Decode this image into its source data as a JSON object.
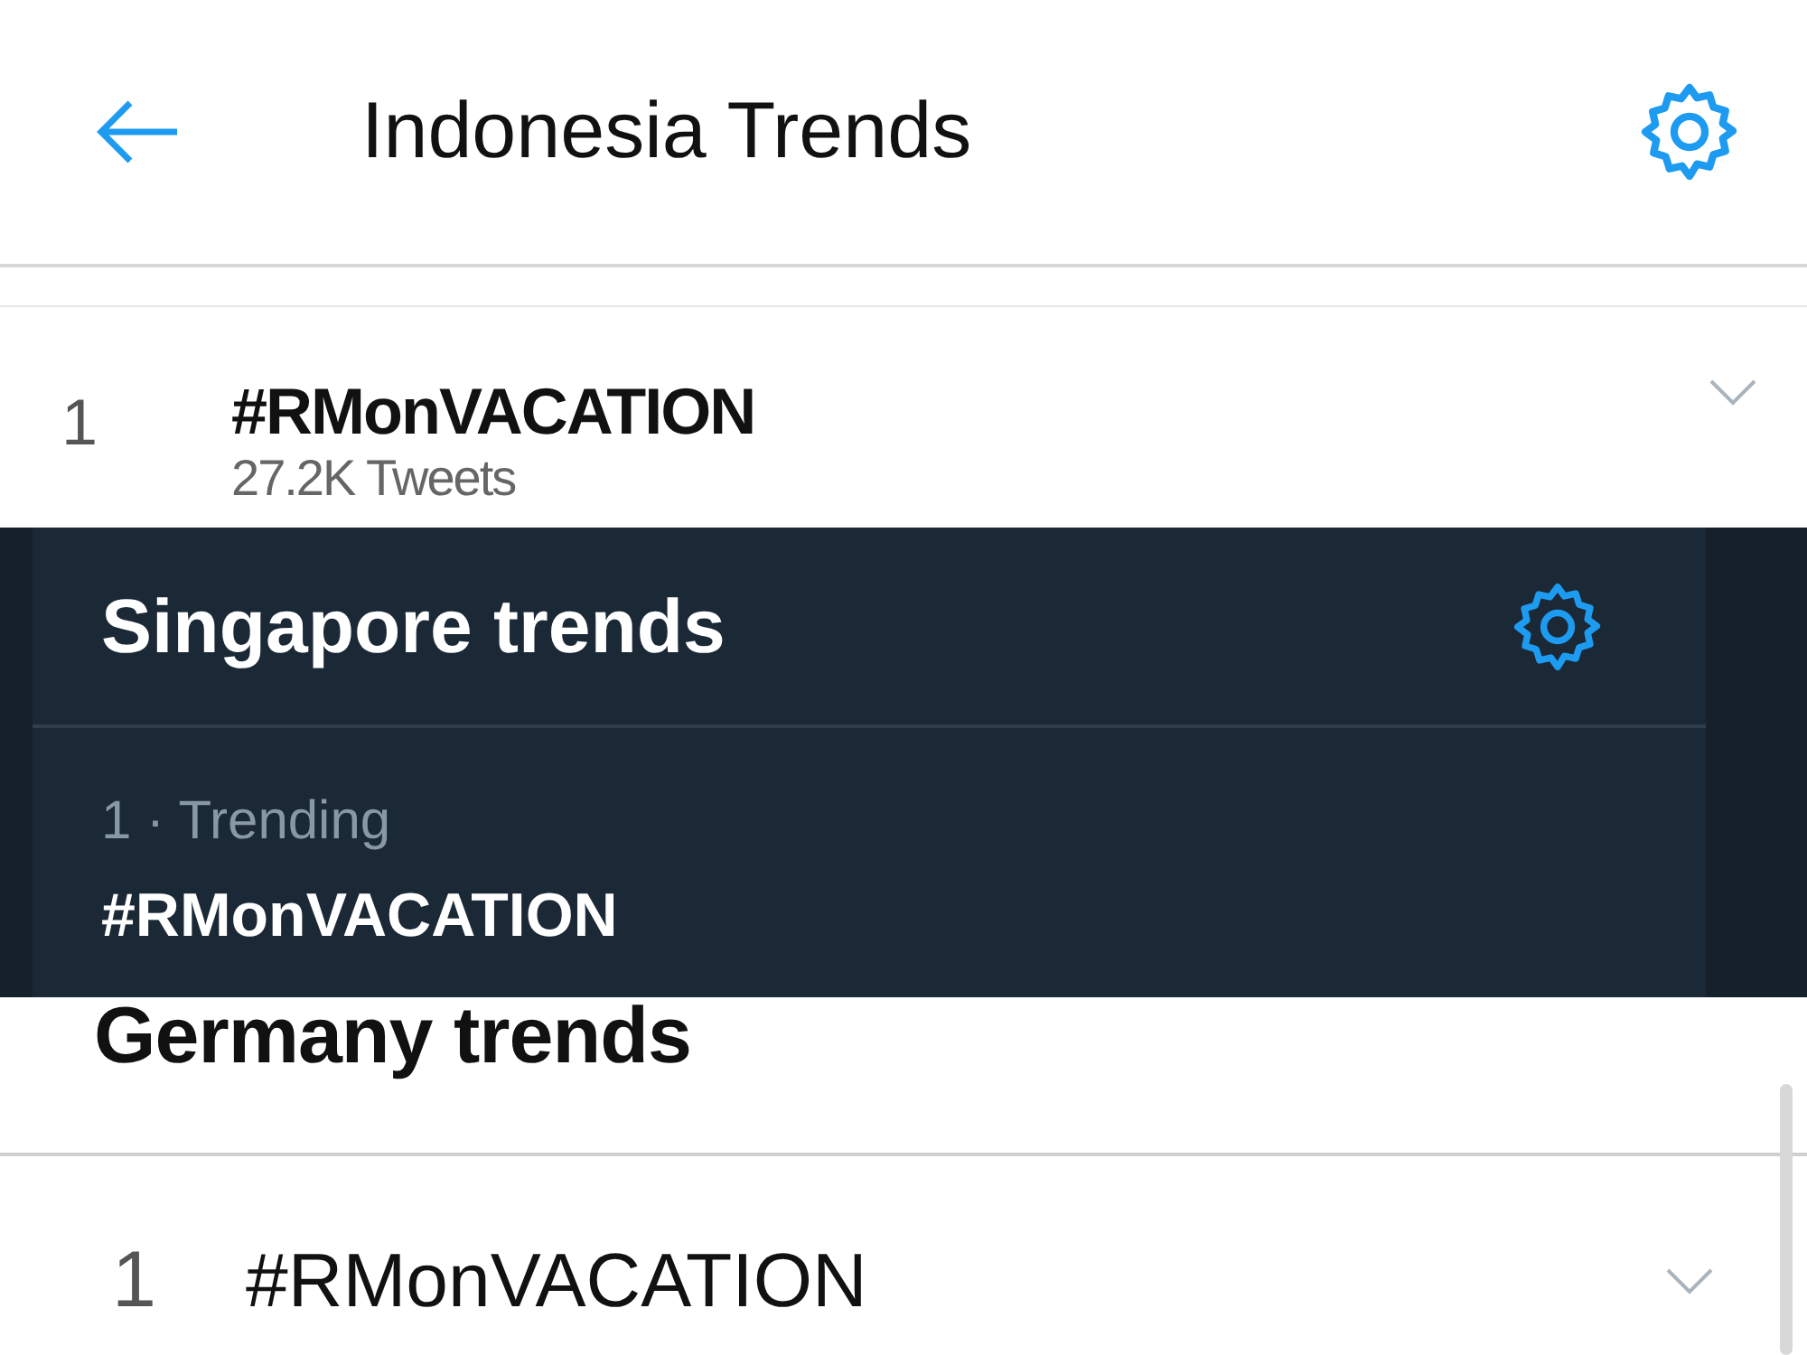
{
  "panels": [
    {
      "kind": "light_header",
      "title": "Indonesia Trends",
      "trends": [
        {
          "rank": "1",
          "name": "#RMonVACATION",
          "count": "27.2K Tweets"
        }
      ]
    },
    {
      "kind": "dark",
      "title": "Singapore trends",
      "trends": [
        {
          "rank": "1 · Trending",
          "name": "#RMonVACATION"
        }
      ]
    },
    {
      "kind": "light",
      "title": "Germany trends",
      "trends": [
        {
          "rank": "1",
          "name": "#RMonVACATION"
        }
      ]
    }
  ]
}
